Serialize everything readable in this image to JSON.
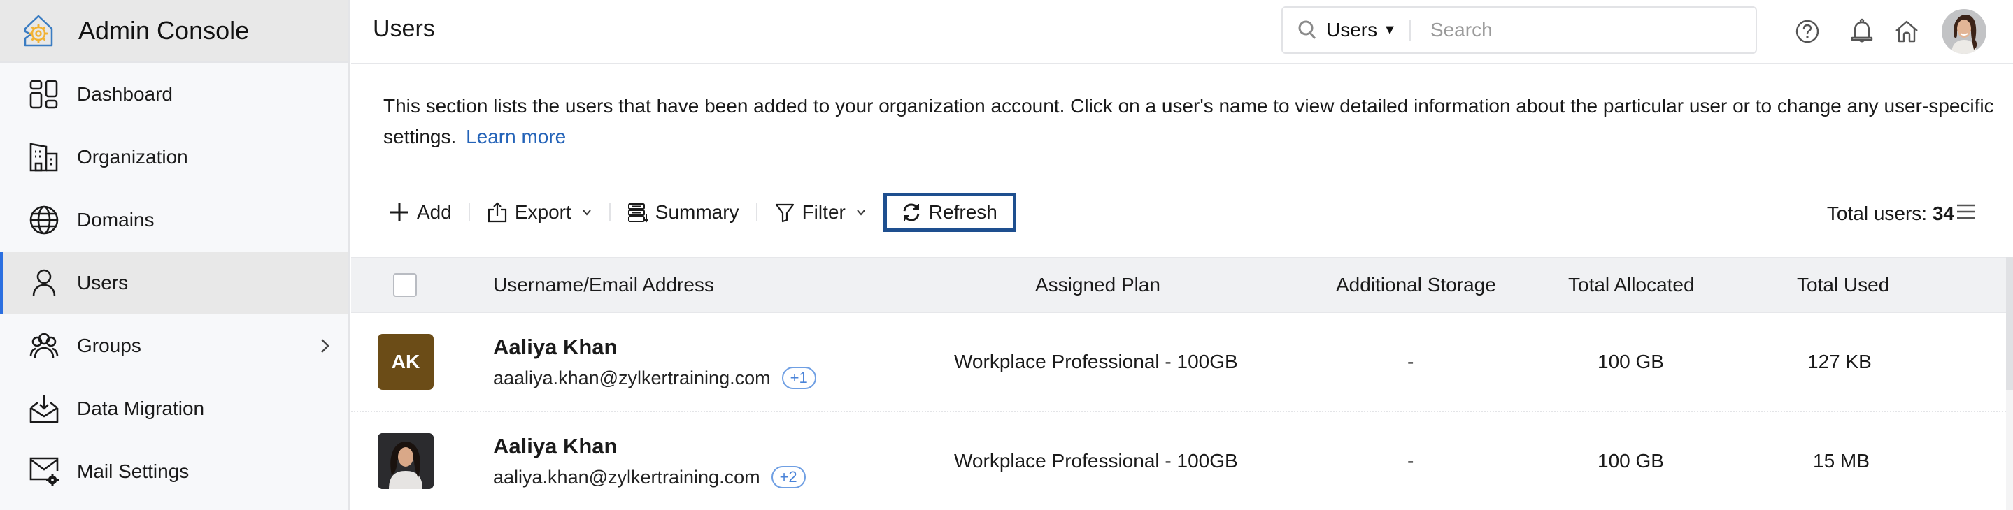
{
  "app": {
    "title": "Admin Console",
    "brand_colors": {
      "logo_outline": "#3a7cc2",
      "logo_gear": "#f2b233"
    }
  },
  "sidebar": {
    "items": [
      {
        "label": "Dashboard",
        "icon": "dashboard-icon",
        "active": false
      },
      {
        "label": "Organization",
        "icon": "building-icon",
        "active": false
      },
      {
        "label": "Domains",
        "icon": "globe-icon",
        "active": false
      },
      {
        "label": "Users",
        "icon": "user-icon",
        "active": true
      },
      {
        "label": "Groups",
        "icon": "group-icon",
        "active": false,
        "has_submenu": true
      },
      {
        "label": "Data Migration",
        "icon": "inbox-download-icon",
        "active": false
      },
      {
        "label": "Mail Settings",
        "icon": "mail-settings-icon",
        "active": false
      }
    ],
    "active_color": "#2b6fe0"
  },
  "header": {
    "page_title": "Users",
    "search": {
      "scope": "Users",
      "placeholder": "Search",
      "value": ""
    },
    "icons": [
      "help-icon",
      "bell-icon",
      "home-icon",
      "profile-avatar"
    ]
  },
  "content": {
    "description": "This section lists the users that have been added to your organization account. Click on a user's name to view detailed information about the particular user or to change any user-specific settings.",
    "learn_more": "Learn more",
    "toolbar": {
      "add": "Add",
      "export": "Export",
      "summary": "Summary",
      "filter": "Filter",
      "refresh": "Refresh"
    },
    "total_users_label": "Total users:",
    "total_users_value": "34"
  },
  "table": {
    "columns": [
      "Username/Email Address",
      "Assigned Plan",
      "Additional Storage",
      "Total Allocated",
      "Total Used"
    ],
    "rows": [
      {
        "avatar_initials": "AK",
        "avatar_color": "#6b4c17",
        "avatar_type": "initials",
        "name": "Aaliya Khan",
        "email": "aaaliya.khan@zylkertraining.com",
        "alias_badge": "+1",
        "plan": "Workplace Professional - 100GB",
        "additional_storage": "-",
        "total_allocated": "100 GB",
        "total_used": "127 KB"
      },
      {
        "avatar_initials": "",
        "avatar_color": "#2b2b2e",
        "avatar_type": "photo",
        "name": "Aaliya Khan",
        "email": "aaliya.khan@zylkertraining.com",
        "alias_badge": "+2",
        "plan": "Workplace Professional - 100GB",
        "additional_storage": "-",
        "total_allocated": "100 GB",
        "total_used": "15 MB"
      }
    ]
  }
}
